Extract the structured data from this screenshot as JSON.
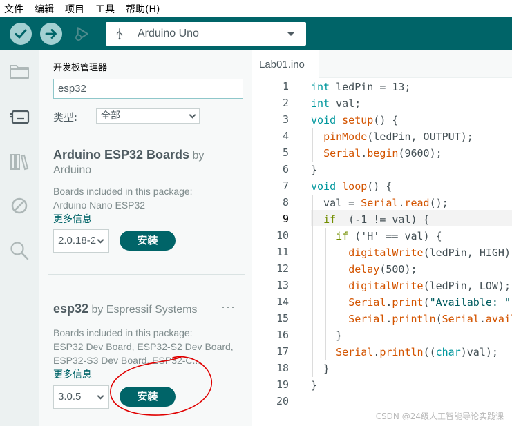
{
  "menu": [
    "文件",
    "编辑",
    "项目",
    "工具",
    "帮助(H)"
  ],
  "toolbar": {
    "board": "Arduino Uno",
    "colors": {
      "toolbar": "#006468",
      "button": "#a3d0d2"
    }
  },
  "sidebar_icons": [
    "folder-icon",
    "board-manager-icon",
    "library-icon",
    "debug-icon",
    "search-icon"
  ],
  "board_manager": {
    "title": "开发板管理器",
    "search_value": "esp32",
    "type_label": "类型:",
    "type_value": "全部",
    "cards": [
      {
        "name": "Arduino ESP32 Boards",
        "by": "by",
        "author": "Arduino",
        "desc_prefix": "Boards included in this package:",
        "desc": "Arduino Nano ESP32",
        "more": "更多信息",
        "version": "2.0.18-2",
        "install": "安装"
      },
      {
        "name": "esp32",
        "by": "by",
        "author": "Espressif Systems",
        "menu": "···",
        "desc_prefix": "Boards included in this package:",
        "desc": "ESP32 Dev Board, ESP32-S2 Dev Board, ESP32-S3 Dev Board, ESP32-C...",
        "more": "更多信息",
        "version": "3.0.5",
        "install": "安装"
      }
    ]
  },
  "editor": {
    "tab": "Lab01.ino",
    "current_line": 9,
    "line_numbers": [
      "1",
      "2",
      "3",
      "4",
      "5",
      "6",
      "7",
      "8",
      "9",
      "10",
      "11",
      "12",
      "13",
      "14",
      "15",
      "16",
      "17",
      "18",
      "19",
      "20"
    ]
  },
  "watermark": "CSDN @24级人工智能导论实践课"
}
